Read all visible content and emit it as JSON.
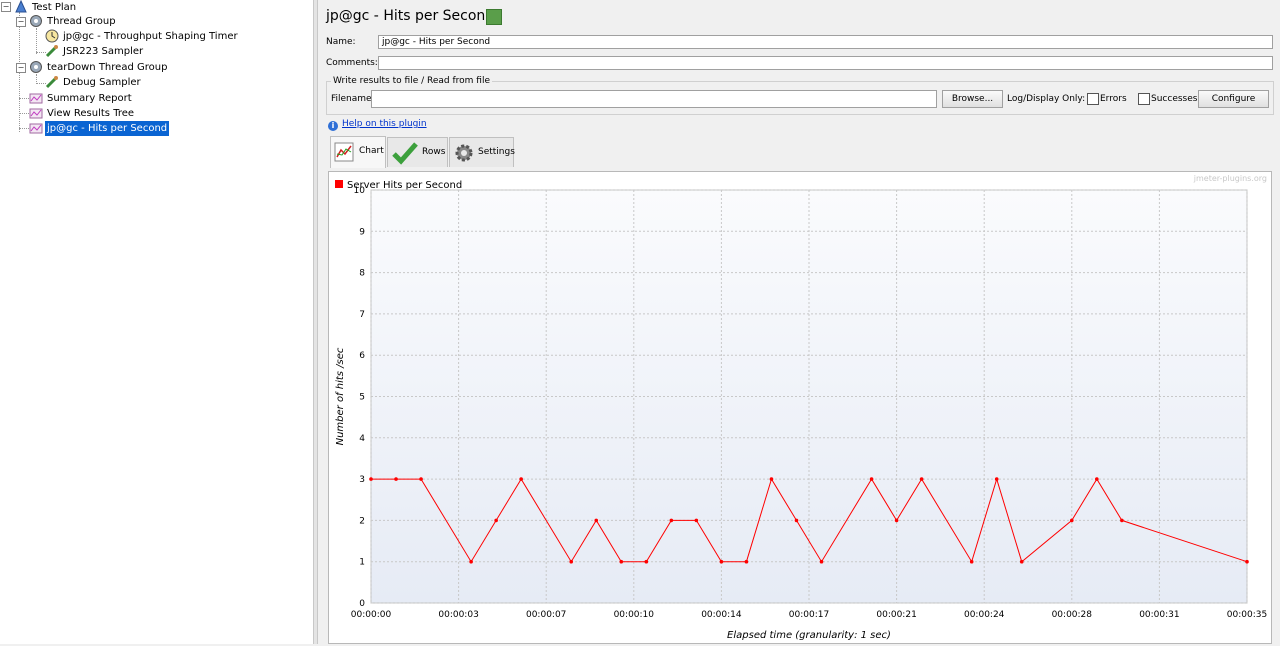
{
  "tree": {
    "items": [
      {
        "label": "Test Plan",
        "icon": "test-plan-icon"
      },
      {
        "label": "Thread Group",
        "icon": "thread-group-icon"
      },
      {
        "label": "jp@gc - Throughput Shaping Timer",
        "icon": "timer-icon"
      },
      {
        "label": "JSR223 Sampler",
        "icon": "sampler-icon"
      },
      {
        "label": "tearDown Thread Group",
        "icon": "thread-group-icon"
      },
      {
        "label": "Debug Sampler",
        "icon": "sampler-icon"
      },
      {
        "label": "Summary Report",
        "icon": "listener-icon"
      },
      {
        "label": "View Results Tree",
        "icon": "listener-icon"
      },
      {
        "label": "jp@gc - Hits per Second",
        "icon": "listener-icon"
      }
    ]
  },
  "panel": {
    "title": "jp@gc - Hits per Second",
    "name_label": "Name:",
    "name_value": "jp@gc - Hits per Second",
    "comments_label": "Comments:",
    "comments_value": "",
    "file_group_title": "Write results to file / Read from file",
    "filename_label": "Filename",
    "filename_value": "",
    "browse_label": "Browse...",
    "log_display_label": "Log/Display Only:",
    "errors_label": "Errors",
    "successes_label": "Successes",
    "configure_label": "Configure",
    "help_link": "Help on this plugin",
    "tabs": {
      "chart": "Chart",
      "rows": "Rows",
      "settings": "Settings"
    },
    "watermark": "jmeter-plugins.org"
  },
  "chart_data": {
    "type": "line",
    "series": [
      {
        "name": "Server Hits per Second",
        "color": "#ff0000",
        "x": [
          "00:00:00",
          "00:00:01",
          "00:00:02",
          "00:00:04",
          "00:00:05",
          "00:00:06",
          "00:00:08",
          "00:00:09",
          "00:00:10",
          "00:00:11",
          "00:00:12",
          "00:00:13",
          "00:00:14",
          "00:00:15",
          "00:00:16",
          "00:00:17",
          "00:00:18",
          "00:00:20",
          "00:00:21",
          "00:00:22",
          "00:00:24",
          "00:00:25",
          "00:00:26",
          "00:00:28",
          "00:00:29",
          "00:00:30",
          "00:00:35"
        ],
        "values": [
          3,
          3,
          3,
          1,
          2,
          3,
          1,
          2,
          1,
          1,
          2,
          2,
          1,
          1,
          3,
          2,
          1,
          3,
          2,
          3,
          1,
          3,
          1,
          2,
          3,
          2,
          1
        ]
      }
    ],
    "xlabel": "Elapsed time (granularity: 1 sec)",
    "ylabel": "Number of hits /sec",
    "ylim": [
      0,
      10
    ],
    "yticks": [
      "0",
      "1",
      "2",
      "3",
      "4",
      "5",
      "6",
      "7",
      "8",
      "9",
      "10"
    ],
    "xticks": [
      "00:00:00",
      "00:00:03",
      "00:00:07",
      "00:00:10",
      "00:00:14",
      "00:00:17",
      "00:00:21",
      "00:00:24",
      "00:00:28",
      "00:00:31",
      "00:00:35"
    ],
    "xtick_seconds": [
      0,
      3.5,
      7,
      10.5,
      14,
      17.5,
      21,
      24.5,
      28,
      31.5,
      35
    ],
    "xlim_seconds": [
      0,
      35
    ],
    "legend_position": "top-left",
    "grid": true
  }
}
